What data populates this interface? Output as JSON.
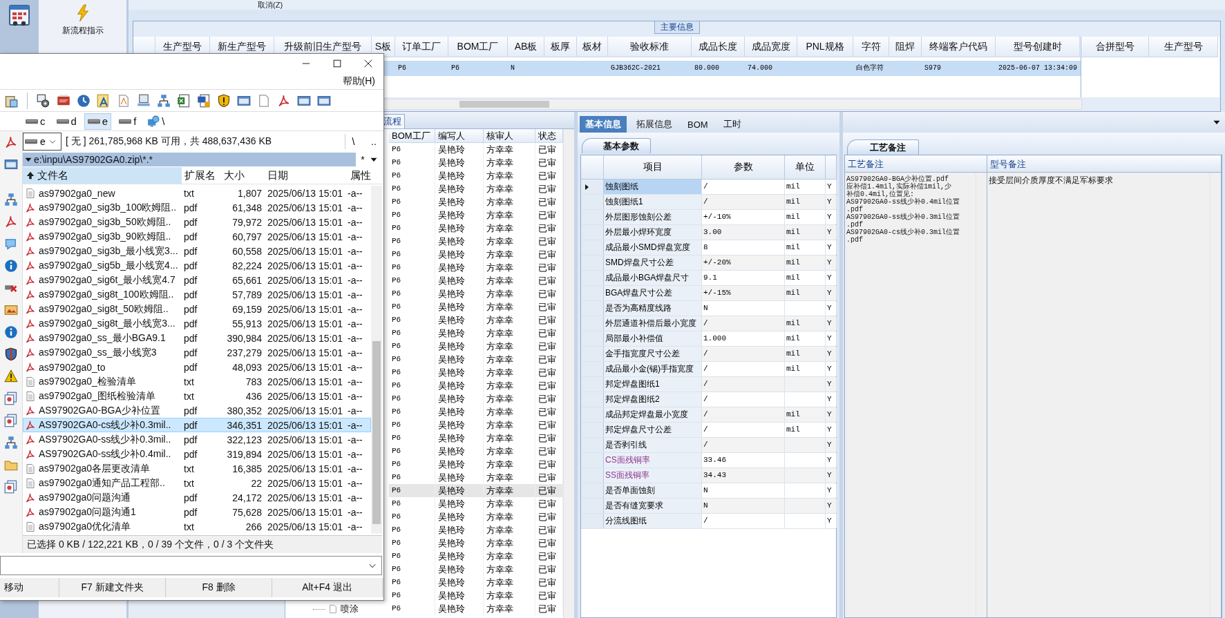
{
  "app_toolbar": {
    "launcher_label": "新流程指示"
  },
  "top_strip": {
    "cancel": "取消(Z)"
  },
  "main_info": {
    "title": "主要信息",
    "columns": [
      "生产型号",
      "新生产型号",
      "升级前旧生产型号",
      "S板",
      "订单工厂",
      "BOM工厂",
      "AB板",
      "板厚",
      "板材",
      "验收标准",
      "成品长度",
      "成品宽度",
      "PNL规格",
      "字符",
      "阻焊",
      "终端客户代码",
      "型号创建时"
    ],
    "rows": [
      {
        "selected": true,
        "cells": [
          null,
          null,
          null,
          null,
          "P6",
          "P6",
          "N",
          null,
          null,
          "GJB362C-2021",
          "80.000",
          "74.000",
          null,
          "白色字符",
          null,
          "S979",
          "2025-06-07 13:34:09"
        ]
      }
    ],
    "merge_columns": [
      "合拼型号",
      "生产型号"
    ]
  },
  "flow_panel": {
    "tab": "流程",
    "columns": [
      "BOM工厂",
      "编写人",
      "核审人",
      "状态"
    ],
    "rows": [
      {
        "cells": [
          "P6",
          "吴艳玲",
          "方幸幸",
          "已审"
        ],
        "selected": false
      },
      {
        "cells": [
          "P6",
          "吴艳玲",
          "方幸幸",
          "已审"
        ],
        "selected": false
      },
      {
        "cells": [
          "P6",
          "吴艳玲",
          "方幸幸",
          "已审"
        ],
        "selected": false
      },
      {
        "cells": [
          "P6",
          "吴艳玲",
          "方幸幸",
          "已审"
        ],
        "selected": false
      },
      {
        "cells": [
          "P6",
          "吴艳玲",
          "方幸幸",
          "已审"
        ],
        "selected": false
      },
      {
        "cells": [
          "P6",
          "吴艳玲",
          "方幸幸",
          "已审"
        ],
        "selected": false
      },
      {
        "cells": [
          "P6",
          "吴艳玲",
          "方幸幸",
          "已审"
        ],
        "selected": false
      },
      {
        "cells": [
          "P6",
          "吴艳玲",
          "方幸幸",
          "已审"
        ],
        "selected": false
      },
      {
        "cells": [
          "P6",
          "吴艳玲",
          "方幸幸",
          "已审"
        ],
        "selected": false
      },
      {
        "cells": [
          "P6",
          "吴艳玲",
          "方幸幸",
          "已审"
        ],
        "selected": false
      },
      {
        "cells": [
          "P6",
          "吴艳玲",
          "方幸幸",
          "已审"
        ],
        "selected": false
      },
      {
        "cells": [
          "P6",
          "吴艳玲",
          "方幸幸",
          "已审"
        ],
        "selected": false
      },
      {
        "cells": [
          "P6",
          "吴艳玲",
          "方幸幸",
          "已审"
        ],
        "selected": false
      },
      {
        "cells": [
          "P6",
          "吴艳玲",
          "方幸幸",
          "已审"
        ],
        "selected": false
      },
      {
        "cells": [
          "P6",
          "吴艳玲",
          "方幸幸",
          "已审"
        ],
        "selected": false
      },
      {
        "cells": [
          "P6",
          "吴艳玲",
          "方幸幸",
          "已审"
        ],
        "selected": false
      },
      {
        "cells": [
          "P6",
          "吴艳玲",
          "方幸幸",
          "已审"
        ],
        "selected": false
      },
      {
        "cells": [
          "P6",
          "吴艳玲",
          "方幸幸",
          "已审"
        ],
        "selected": false
      },
      {
        "cells": [
          "P6",
          "吴艳玲",
          "方幸幸",
          "已审"
        ],
        "selected": false
      },
      {
        "cells": [
          "P6",
          "吴艳玲",
          "方幸幸",
          "已审"
        ],
        "selected": false
      },
      {
        "cells": [
          "P6",
          "吴艳玲",
          "方幸幸",
          "已审"
        ],
        "selected": false
      },
      {
        "cells": [
          "P6",
          "吴艳玲",
          "方幸幸",
          "已审"
        ],
        "selected": false
      },
      {
        "cells": [
          "P6",
          "吴艳玲",
          "方幸幸",
          "已审"
        ],
        "selected": false
      },
      {
        "cells": [
          "P6",
          "吴艳玲",
          "方幸幸",
          "已审"
        ],
        "selected": false
      },
      {
        "cells": [
          "P6",
          "吴艳玲",
          "方幸幸",
          "已审"
        ],
        "selected": false
      },
      {
        "cells": [
          "P6",
          "吴艳玲",
          "方幸幸",
          "已审"
        ],
        "selected": false
      },
      {
        "cells": [
          "P6",
          "吴艳玲",
          "方幸幸",
          "已审"
        ],
        "selected": true
      },
      {
        "cells": [
          "P6",
          "吴艳玲",
          "方幸幸",
          "已审"
        ],
        "selected": false
      },
      {
        "cells": [
          "P6",
          "吴艳玲",
          "方幸幸",
          "已审"
        ],
        "selected": false
      },
      {
        "cells": [
          "P6",
          "吴艳玲",
          "方幸幸",
          "已审"
        ],
        "selected": false
      },
      {
        "cells": [
          "P6",
          "吴艳玲",
          "方幸幸",
          "已审"
        ],
        "selected": false
      },
      {
        "cells": [
          "P6",
          "吴艳玲",
          "方幸幸",
          "已审"
        ],
        "selected": false
      },
      {
        "cells": [
          "P6",
          "吴艳玲",
          "方幸幸",
          "已审"
        ],
        "selected": false
      },
      {
        "cells": [
          "P6",
          "吴艳玲",
          "方幸幸",
          "已审"
        ],
        "selected": false
      },
      {
        "cells": [
          "P6",
          "吴艳玲",
          "方幸幸",
          "已审"
        ],
        "selected": false
      },
      {
        "cells": [
          "P6",
          "吴艳玲",
          "方幸幸",
          "已审"
        ],
        "selected": false
      }
    ],
    "tree": [
      {
        "label": "喷涂"
      }
    ]
  },
  "detail_tabs": [
    {
      "label": "基本信息",
      "selected": true
    },
    {
      "label": "拓展信息",
      "selected": false
    },
    {
      "label": "BOM",
      "selected": false
    },
    {
      "label": "工时",
      "selected": false
    }
  ],
  "basic_params": {
    "tab": "基本参数",
    "columns": [
      "项目",
      "参数",
      "单位"
    ],
    "rows": [
      {
        "item": "蚀刻图纸",
        "value": "/",
        "unit": "mil",
        "flag": "Y",
        "selected": true,
        "kind": "standard"
      },
      {
        "item": "蚀刻图纸1",
        "value": "/",
        "unit": "mil",
        "flag": "Y",
        "selected": false,
        "kind": "standard"
      },
      {
        "item": "外层图形蚀刻公差",
        "value": "+/-10%",
        "unit": "mil",
        "flag": "Y",
        "selected": false,
        "kind": "standard"
      },
      {
        "item": "外层最小焊环宽度",
        "value": "3.00",
        "unit": "mil",
        "flag": "Y",
        "selected": false,
        "kind": "standard"
      },
      {
        "item": "成品最小SMD焊盘宽度",
        "value": "8",
        "unit": "mil",
        "flag": "Y",
        "selected": false,
        "kind": "standard"
      },
      {
        "item": "SMD焊盘尺寸公差",
        "value": "+/-20%",
        "unit": "mil",
        "flag": "Y",
        "selected": false,
        "kind": "standard"
      },
      {
        "item": "成品最小BGA焊盘尺寸",
        "value": "9.1",
        "unit": "mil",
        "flag": "Y",
        "selected": false,
        "kind": "standard"
      },
      {
        "item": "BGA焊盘尺寸公差",
        "value": "+/-15%",
        "unit": "mil",
        "flag": "Y",
        "selected": false,
        "kind": "standard"
      },
      {
        "item": "是否为高精度线路",
        "value": "N",
        "flag": "Y",
        "selected": false,
        "kind": "standard"
      },
      {
        "item": "外层通道补偿后最小宽度",
        "value": "/",
        "unit": "mil",
        "flag": "Y",
        "selected": false,
        "kind": "standard"
      },
      {
        "item": "局部最小补偿值",
        "value": "1.000",
        "unit": "mil",
        "flag": "Y",
        "selected": false,
        "kind": "standard"
      },
      {
        "item": "金手指宽度尺寸公差",
        "value": "/",
        "unit": "mil",
        "flag": "Y",
        "selected": false,
        "kind": "standard"
      },
      {
        "item": "成品最小金(锡)手指宽度",
        "value": "/",
        "unit": "mil",
        "flag": "Y",
        "selected": false,
        "kind": "standard"
      },
      {
        "item": "邦定焊盘图纸1",
        "value": "/",
        "flag": "Y",
        "selected": false,
        "kind": "standard"
      },
      {
        "item": "邦定焊盘图纸2",
        "value": "/",
        "flag": "Y",
        "selected": false,
        "kind": "standard"
      },
      {
        "item": "成品邦定焊盘最小宽度",
        "value": "/",
        "unit": "mil",
        "flag": "Y",
        "selected": false,
        "kind": "standard"
      },
      {
        "item": "邦定焊盘尺寸公差",
        "value": "/",
        "unit": "mil",
        "flag": "Y",
        "selected": false,
        "kind": "standard"
      },
      {
        "item": "是否剥引线",
        "value": "/",
        "flag": "Y",
        "selected": false,
        "kind": "standard"
      },
      {
        "item": "CS面残铜率",
        "value": "33.46",
        "flag": "Y",
        "selected": false,
        "kind": "highlighted"
      },
      {
        "item": "SS面残铜率",
        "value": "34.43",
        "flag": "Y",
        "selected": false,
        "kind": "highlighted"
      },
      {
        "item": "是否单面蚀刻",
        "value": "N",
        "flag": "Y",
        "selected": false,
        "kind": "standard"
      },
      {
        "item": "是否有缝宽要求",
        "value": "N",
        "flag": "Y",
        "selected": false,
        "kind": "standard"
      },
      {
        "item": "分流线图纸",
        "value": "/",
        "flag": "Y",
        "selected": false,
        "kind": "standard"
      }
    ]
  },
  "process_notes": {
    "tab": "工艺备注",
    "columns": [
      "工艺备注",
      "型号备注"
    ],
    "process_note_lines": [
      "AS97902GA0-BGA少补位置.pdf",
      "应补偿1.4mil,实际补偿1mil,少",
      "补偿0.4mil,位置见:",
      "AS97902GA0-ss线少补0.4mil位置",
      ".pdf",
      "AS97902GA0-ss线少补0.3mil位置",
      ".pdf",
      "AS97902GA0-cs线少补0.3mil位置",
      ".pdf"
    ],
    "model_note": "接受层间介质厚度不满足军标要求"
  },
  "file_manager": {
    "menu": [
      "帮助(H)"
    ],
    "drives": [
      {
        "label": "c",
        "kind": "drive",
        "selected": false
      },
      {
        "label": "d",
        "kind": "drive",
        "selected": false
      },
      {
        "label": "e",
        "kind": "drive",
        "selected": true
      },
      {
        "label": "f",
        "kind": "drive",
        "selected": false
      },
      {
        "label": "\\",
        "kind": "network",
        "selected": false
      }
    ],
    "drive_combo": "e",
    "free_space": "[ 无 ]  261,785,968 KB 可用，共 488,637,436 KB",
    "root_button": "\\",
    "parent_button": "..",
    "path": "e:\\inpu\\AS97902GA0.zip\\*.*",
    "filter": "*",
    "columns": [
      {
        "label": "文件名",
        "sorted": true
      },
      {
        "label": "扩展名",
        "sorted": false
      },
      {
        "label": "大小",
        "sorted": false
      },
      {
        "label": "日期",
        "sorted": false
      },
      {
        "label": "属性",
        "sorted": false
      }
    ],
    "files": [
      {
        "name": "as97902ga0_new",
        "ext": "txt",
        "size": "1,807",
        "date": "2025/06/13 15:01",
        "attr": "-a--",
        "kind": "txt",
        "selected": false
      },
      {
        "name": "as97902ga0_sig3b_100欧姆阻..",
        "ext": "pdf",
        "size": "61,348",
        "date": "2025/06/13 15:01",
        "attr": "-a--",
        "kind": "pdf",
        "selected": false
      },
      {
        "name": "as97902ga0_sig3b_50欧姆阻..",
        "ext": "pdf",
        "size": "79,972",
        "date": "2025/06/13 15:01",
        "attr": "-a--",
        "kind": "pdf",
        "selected": false
      },
      {
        "name": "as97902ga0_sig3b_90欧姆阻..",
        "ext": "pdf",
        "size": "60,797",
        "date": "2025/06/13 15:01",
        "attr": "-a--",
        "kind": "pdf",
        "selected": false
      },
      {
        "name": "as97902ga0_sig3b_最小线宽3...",
        "ext": "pdf",
        "size": "60,558",
        "date": "2025/06/13 15:01",
        "attr": "-a--",
        "kind": "pdf",
        "selected": false
      },
      {
        "name": "as97902ga0_sig5b_最小线宽4...",
        "ext": "pdf",
        "size": "82,224",
        "date": "2025/06/13 15:01",
        "attr": "-a--",
        "kind": "pdf",
        "selected": false
      },
      {
        "name": "as97902ga0_sig6t_最小线宽4.7",
        "ext": "pdf",
        "size": "65,661",
        "date": "2025/06/13 15:01",
        "attr": "-a--",
        "kind": "pdf",
        "selected": false
      },
      {
        "name": "as97902ga0_sig8t_100欧姆阻..",
        "ext": "pdf",
        "size": "57,789",
        "date": "2025/06/13 15:01",
        "attr": "-a--",
        "kind": "pdf",
        "selected": false
      },
      {
        "name": "as97902ga0_sig8t_50欧姆阻..",
        "ext": "pdf",
        "size": "69,159",
        "date": "2025/06/13 15:01",
        "attr": "-a--",
        "kind": "pdf",
        "selected": false
      },
      {
        "name": "as97902ga0_sig8t_最小线宽3...",
        "ext": "pdf",
        "size": "55,913",
        "date": "2025/06/13 15:01",
        "attr": "-a--",
        "kind": "pdf",
        "selected": false
      },
      {
        "name": "as97902ga0_ss_最小BGA9.1",
        "ext": "pdf",
        "size": "390,984",
        "date": "2025/06/13 15:01",
        "attr": "-a--",
        "kind": "pdf",
        "selected": false
      },
      {
        "name": "as97902ga0_ss_最小线宽3",
        "ext": "pdf",
        "size": "237,279",
        "date": "2025/06/13 15:01",
        "attr": "-a--",
        "kind": "pdf",
        "selected": false
      },
      {
        "name": "as97902ga0_to",
        "ext": "pdf",
        "size": "48,093",
        "date": "2025/06/13 15:01",
        "attr": "-a--",
        "kind": "pdf",
        "selected": false
      },
      {
        "name": "as97902ga0_检验清单",
        "ext": "txt",
        "size": "783",
        "date": "2025/06/13 15:01",
        "attr": "-a--",
        "kind": "txt",
        "selected": false
      },
      {
        "name": "as97902ga0_图纸检验清单",
        "ext": "txt",
        "size": "436",
        "date": "2025/06/13 15:01",
        "attr": "-a--",
        "kind": "txt",
        "selected": false
      },
      {
        "name": "AS97902GA0-BGA少补位置",
        "ext": "pdf",
        "size": "380,352",
        "date": "2025/06/13 15:01",
        "attr": "-a--",
        "kind": "pdf",
        "selected": false
      },
      {
        "name": "AS97902GA0-cs线少补0.3mil..",
        "ext": "pdf",
        "size": "346,351",
        "date": "2025/06/13 15:01",
        "attr": "-a--",
        "kind": "pdf",
        "selected": true
      },
      {
        "name": "AS97902GA0-ss线少补0.3mil..",
        "ext": "pdf",
        "size": "322,123",
        "date": "2025/06/13 15:01",
        "attr": "-a--",
        "kind": "pdf",
        "selected": false
      },
      {
        "name": "AS97902GA0-ss线少补0.4mil..",
        "ext": "pdf",
        "size": "319,894",
        "date": "2025/06/13 15:01",
        "attr": "-a--",
        "kind": "pdf",
        "selected": false
      },
      {
        "name": "as97902ga0各层更改清单",
        "ext": "txt",
        "size": "16,385",
        "date": "2025/06/13 15:01",
        "attr": "-a--",
        "kind": "txt",
        "selected": false
      },
      {
        "name": "as97902ga0通知产品工程部..",
        "ext": "txt",
        "size": "22",
        "date": "2025/06/13 15:01",
        "attr": "-a--",
        "kind": "txt",
        "selected": false
      },
      {
        "name": "as97902ga0问题沟通",
        "ext": "pdf",
        "size": "24,172",
        "date": "2025/06/13 15:01",
        "attr": "-a--",
        "kind": "pdf",
        "selected": false
      },
      {
        "name": "as97902ga0问题沟通1",
        "ext": "pdf",
        "size": "75,628",
        "date": "2025/06/13 15:01",
        "attr": "-a--",
        "kind": "pdf",
        "selected": false
      },
      {
        "name": "as97902ga0优化清单",
        "ext": "txt",
        "size": "266",
        "date": "2025/06/13 15:01",
        "attr": "-a--",
        "kind": "txt",
        "selected": false
      }
    ],
    "status": "已选择 0 KB / 122,221 KB，0 / 39 个文件，0 / 3 个文件夹",
    "function_keys": [
      "移动",
      "F7 新建文件夹",
      "F8 删除",
      "Alt+F4 退出"
    ]
  }
}
